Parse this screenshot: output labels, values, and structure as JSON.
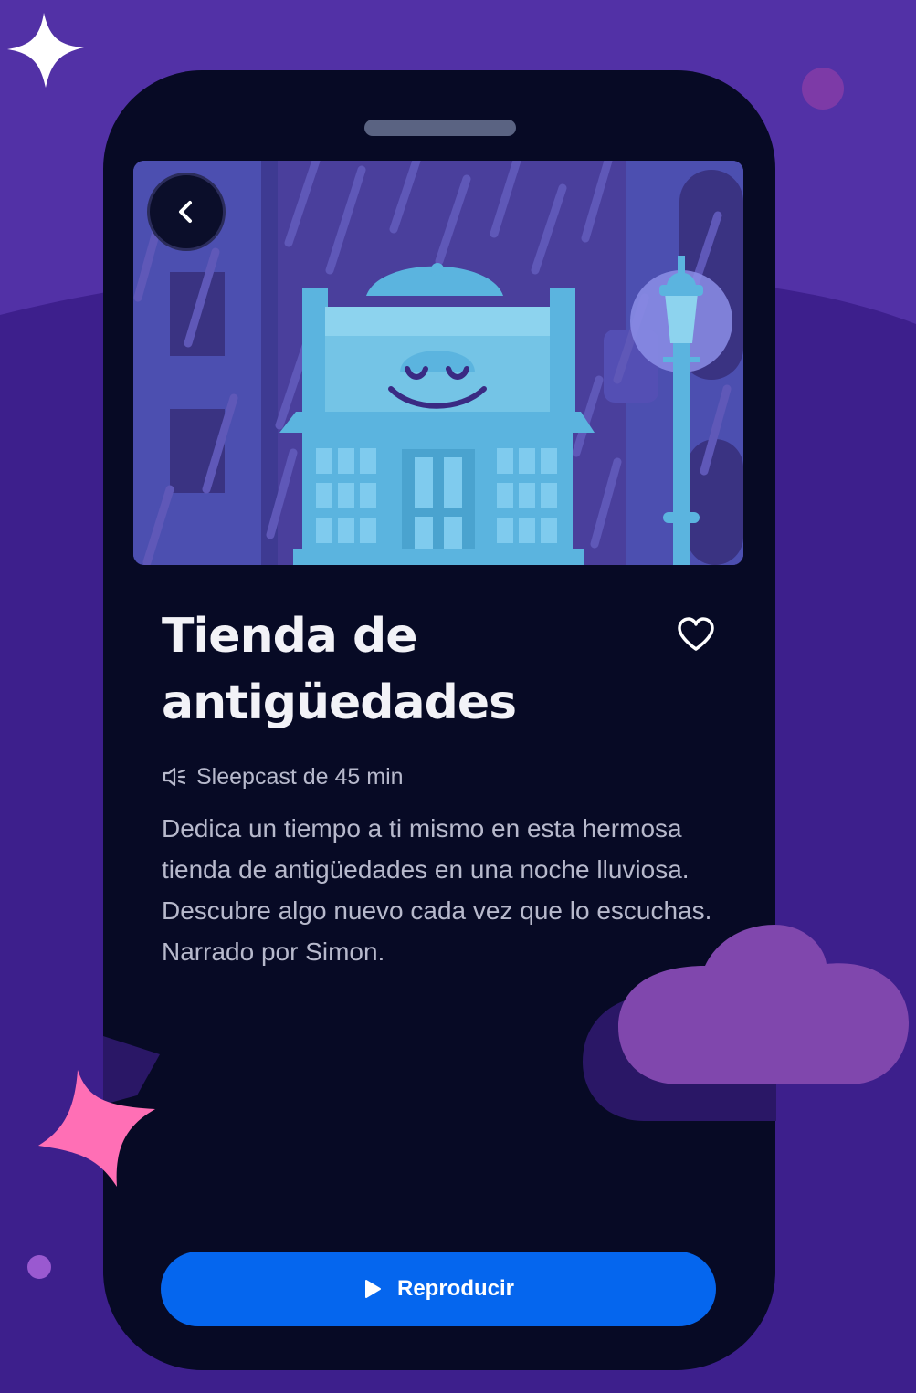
{
  "sleepcast": {
    "title": "Tienda de antigüedades",
    "meta_label": "Sleepcast de 45 min",
    "description": "Dedica un tiempo a ti mismo en esta hermosa tienda de antigüedades en una noche lluviosa. Descubre algo nuevo cada vez que lo escuchas. Narrado por Simon.",
    "play_label": "Reproducir"
  },
  "icons": {
    "back": "chevron-left-icon",
    "favorite": "heart-outline-icon",
    "audio": "sound-icon",
    "play": "play-icon"
  },
  "colors": {
    "background": "#5231a6",
    "background_hill": "#3d1f8c",
    "phone_body": "#070a25",
    "play_button": "#0566ee",
    "title_text": "#f2f2f7",
    "body_text": "#b7b9cc",
    "sparkle_white": "#ffffff",
    "sparkle_pink": "#ff6fb5",
    "cloud": "#8047ad"
  }
}
